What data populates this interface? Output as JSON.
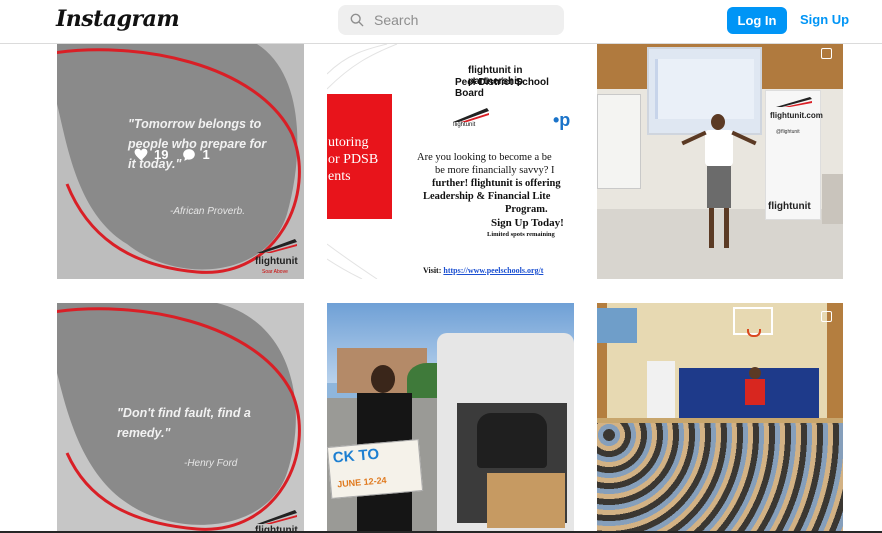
{
  "header": {
    "logo": "Instagram",
    "search_placeholder": "Search",
    "login_label": "Log In",
    "signup_label": "Sign Up"
  },
  "posts": [
    {
      "quote": "\"Tomorrow belongs to people who prepare for it today.\"",
      "author": "-African Proverb.",
      "brand": "flightunit",
      "brand_sub": "Soar Above",
      "likes": "19",
      "comments": "1"
    },
    {
      "brand_line": "flightunit in partnership",
      "partner": "Peel District School Board",
      "red_text": "utoring\nor PDSB\nents",
      "body_1": "Are you looking to become a be",
      "body_2": "be more financially savvy? I",
      "body_3": "further! flightunit is offering",
      "body_4": "Leadership & Financial Lite",
      "body_5": "Program.",
      "cta": "Sign Up Today!",
      "limited": "Limited spots remaining",
      "visit_label": "Visit:",
      "visit_url": "https://www.peelschools.org/t",
      "brand": "flightunit"
    },
    {
      "banner_brand": "flightunit",
      "banner_url": "flightunit.com",
      "banner_handle": "@flightunit",
      "banner_bottom": "flightunit"
    },
    {
      "quote": "\"Don't find fault, find a remedy.\"",
      "author": "-Henry Ford",
      "brand": "flightunit"
    },
    {
      "sign_text": "CK TO",
      "sign_date": "JUNE 12-24"
    },
    {}
  ]
}
